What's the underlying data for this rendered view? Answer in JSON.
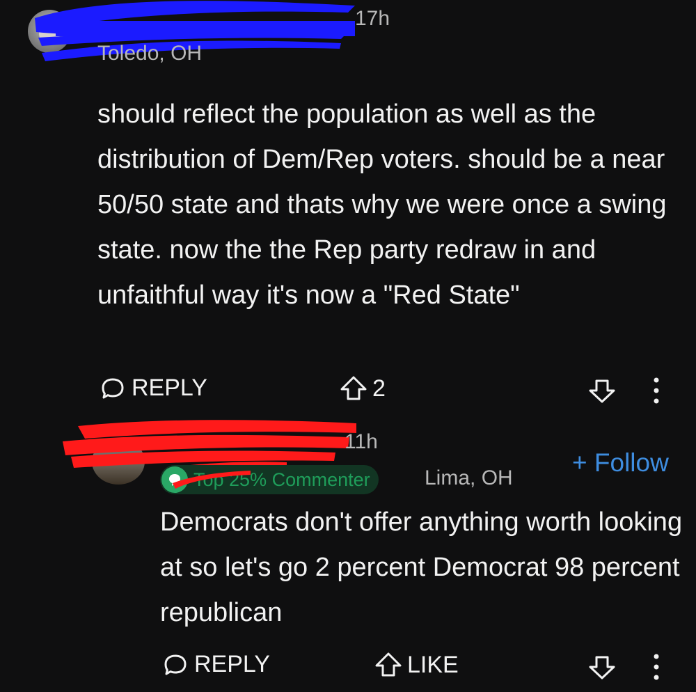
{
  "comment1": {
    "time": "17h",
    "location": "Toledo, OH",
    "body": "should reflect the population as well as the distribution of Dem/Rep voters. should be a near 50/50 state and thats why we were once a swing state. now the the Rep party redraw in and unfaithful way it's now a \"Red State\"",
    "reply_label": "REPLY",
    "upvote_count": "2",
    "icons": [
      "avatar",
      "reply-bubble-icon",
      "upvote-arrow-icon",
      "downvote-arrow-icon",
      "more-vertical-icon"
    ]
  },
  "comment2": {
    "time": "11h",
    "badge": "Top 25% Commenter",
    "location": "Lima, OH",
    "follow_label": "+ Follow",
    "body": "Democrats don't offer anything worth looking at so let's go 2 percent Democrat 98 percent republican",
    "reply_label": "REPLY",
    "like_label": "LIKE",
    "icons": [
      "avatar",
      "badge-icon",
      "reply-bubble-icon",
      "upvote-arrow-icon",
      "downvote-arrow-icon",
      "more-vertical-icon"
    ]
  },
  "colors": {
    "background": "#0f0f10",
    "text": "#f2f2f2",
    "secondary_text": "#b8b8b8",
    "follow_blue": "#3e8de0",
    "badge_green": "#1f9d5a",
    "redaction_blue": "#1b1bff",
    "redaction_red": "#ff1a1a"
  }
}
